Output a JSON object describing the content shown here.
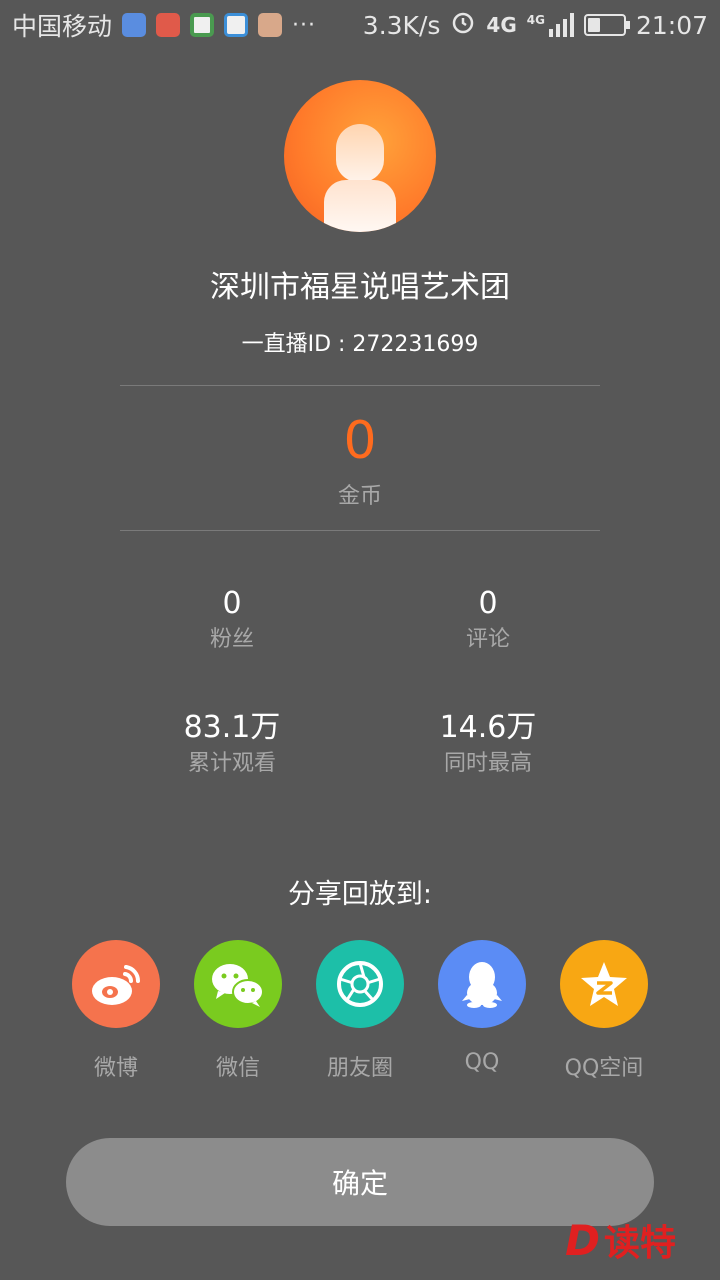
{
  "status_bar": {
    "carrier": "中国移动",
    "more": "···",
    "speed": "3.3K/s",
    "network": "4G",
    "network2": "4G",
    "time": "21:07",
    "battery_level": 0.35
  },
  "profile": {
    "name": "深圳市福星说唱艺术团",
    "id_text": "一直播ID : 272231699"
  },
  "coins": {
    "value": "0",
    "label": "金币"
  },
  "stats": [
    {
      "value": "0",
      "label": "粉丝"
    },
    {
      "value": "0",
      "label": "评论"
    },
    {
      "value": "83.1万",
      "label": "累计观看"
    },
    {
      "value": "14.6万",
      "label": "同时最高"
    }
  ],
  "share": {
    "title": "分享回放到:",
    "targets": [
      {
        "label": "微博",
        "icon": "weibo-icon",
        "color": "#f5734d"
      },
      {
        "label": "微信",
        "icon": "wechat-icon",
        "color": "#7acb1f"
      },
      {
        "label": "朋友圈",
        "icon": "moments-icon",
        "color": "#1dbfa8"
      },
      {
        "label": "QQ",
        "icon": "qq-icon",
        "color": "#5b8cf5"
      },
      {
        "label": "QQ空间",
        "icon": "qzone-icon",
        "color": "#f8a713"
      }
    ]
  },
  "confirm_label": "确定",
  "watermark": {
    "letter": "D",
    "text": "读特"
  }
}
